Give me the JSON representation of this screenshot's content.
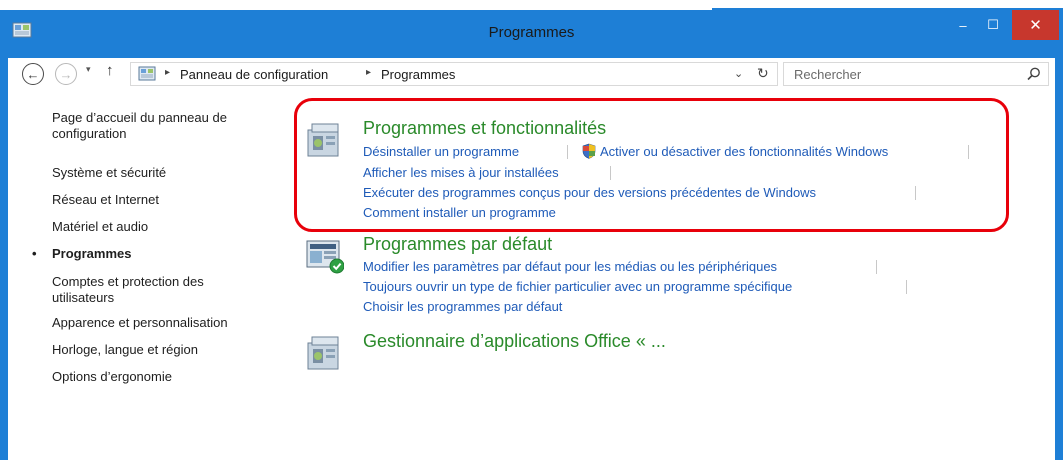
{
  "window": {
    "title": "Programmes",
    "minimize_glyph": "–",
    "maximize_glyph": "☐",
    "close_glyph": "✕"
  },
  "nav": {
    "back_glyph": "←",
    "forward_glyph": "→",
    "recent_glyph": "▾",
    "up_glyph": "↑",
    "breadcrumb": [
      "Panneau de configuration",
      "Programmes"
    ],
    "breadcrumb_sep": "▸",
    "dropdown_glyph": "⌄",
    "refresh_glyph": "↻",
    "search_placeholder": "Rechercher"
  },
  "sidebar": {
    "items": [
      {
        "label": "Page d’accueil du panneau de",
        "label2": "configuration"
      },
      {
        "label": "Système et sécurité"
      },
      {
        "label": "Réseau et Internet"
      },
      {
        "label": "Matériel et audio"
      },
      {
        "label": "Programmes",
        "active": true
      },
      {
        "label": "Comptes et protection des",
        "label2": "utilisateurs"
      },
      {
        "label": "Apparence et personnalisation"
      },
      {
        "label": "Horloge, langue et région"
      },
      {
        "label": "Options d’ergonomie"
      }
    ],
    "bullet": "•"
  },
  "sections": [
    {
      "title": "Programmes et fonctionnalités",
      "icon": "programs-features-icon",
      "links": [
        "Désinstaller un programme",
        "Activer ou désactiver des fonctionnalités Windows",
        "Afficher les mises à jour installées",
        "Exécuter des programmes conçus pour des versions précédentes de Windows",
        "Comment installer un programme"
      ]
    },
    {
      "title": "Programmes par défaut",
      "icon": "default-programs-icon",
      "links": [
        "Modifier les paramètres par défaut pour les médias ou les périphériques",
        "Toujours ouvrir un type de fichier particulier avec un programme spécifique",
        "Choisir les programmes par défaut"
      ]
    },
    {
      "title": "Gestionnaire d’applications Office « ...",
      "icon": "office-app-manager-icon",
      "links": []
    }
  ],
  "colors": {
    "frame": "#1e7fd6",
    "close": "#c7372d",
    "section_title": "#2a8a2a",
    "link": "#1f5bb8",
    "highlight": "#e8000a"
  }
}
